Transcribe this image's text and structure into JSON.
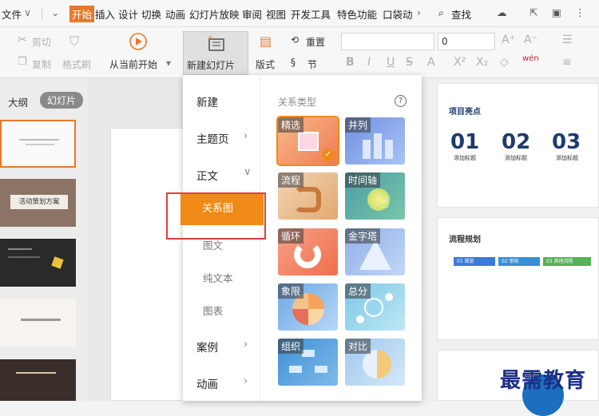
{
  "menu": {
    "file": "文件",
    "items": [
      "开始",
      "插入",
      "设计",
      "切换",
      "动画",
      "幻灯片放映",
      "审阅",
      "视图",
      "开发工具",
      "特色功能",
      "口袋动"
    ],
    "search": "查找"
  },
  "ribbon": {
    "cut": "剪切",
    "copy": "复制",
    "format_painter": "格式刷",
    "from_current": "从当前开始",
    "new_slide": "新建幻灯片",
    "layout": "版式",
    "reset": "重置",
    "section": "节",
    "font_size": "0"
  },
  "panel": {
    "outline_tab": "大纲",
    "slides_tab": "幻灯片",
    "thumb2_title": "活动策划方案"
  },
  "dropdown": {
    "new": "新建",
    "theme": "主题页",
    "body": "正文",
    "relation": "关系图",
    "image_text": "图文",
    "plain_text": "纯文本",
    "chart": "图表",
    "case": "案例",
    "animation": "动画",
    "section_title": "关系类型",
    "cards": [
      "精选",
      "并列",
      "流程",
      "时间轴",
      "循环",
      "金字塔",
      "象限",
      "总分",
      "组织",
      "对比"
    ]
  },
  "preview": {
    "p1_title": "项目亮点",
    "p1_nums": [
      "01",
      "02",
      "03"
    ],
    "p1_caption": "添加标题",
    "p2_title": "流程规划",
    "p2_steps": [
      "01 规划",
      "02 审核",
      "03 其他流程"
    ]
  },
  "watermark": "最需教育",
  "colors": {
    "accent": "#ef8a17",
    "brand": "#e8792b",
    "highlight": "#e0403a"
  }
}
